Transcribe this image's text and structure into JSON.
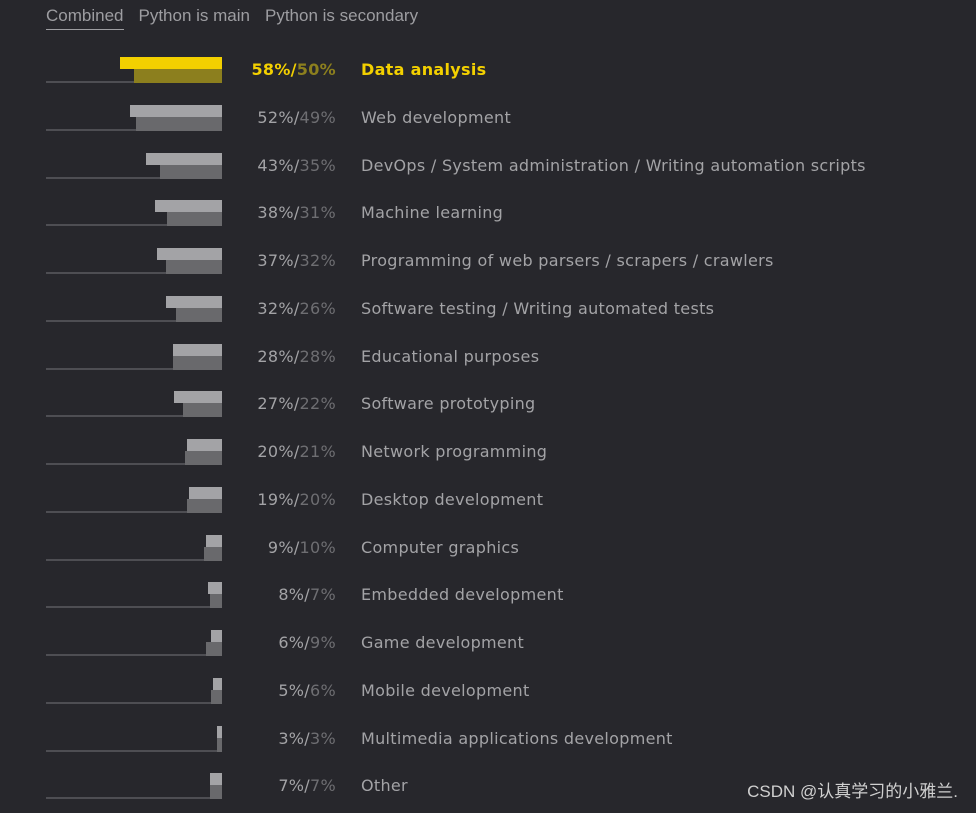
{
  "tabs": [
    {
      "label": "Combined",
      "active": true
    },
    {
      "label": "Python is main",
      "active": false
    },
    {
      "label": "Python is secondary",
      "active": false
    }
  ],
  "colors": {
    "highlight_main": "#f3d000",
    "highlight_secondary": "#8c7f1e",
    "main": "#a3a3a6",
    "secondary": "#69696c",
    "background": "#27272c"
  },
  "chart_data": {
    "type": "bar",
    "orientation": "horizontal",
    "title": "",
    "legend": [
      "Python is main",
      "Python is secondary"
    ],
    "xlim": [
      0,
      100
    ],
    "highlighted_index": 0,
    "categories": [
      "Data analysis",
      "Web development",
      "DevOps / System administration / Writing automation scripts",
      "Machine learning",
      "Programming of web parsers / scrapers / crawlers",
      "Software testing / Writing automated tests",
      "Educational purposes",
      "Software prototyping",
      "Network programming",
      "Desktop development",
      "Computer graphics",
      "Embedded development",
      "Game development",
      "Mobile development",
      "Multimedia applications development",
      "Other"
    ],
    "series": [
      {
        "name": "Python is main",
        "values": [
          58,
          52,
          43,
          38,
          37,
          32,
          28,
          27,
          20,
          19,
          9,
          8,
          6,
          5,
          3,
          7
        ]
      },
      {
        "name": "Python is secondary",
        "values": [
          50,
          49,
          35,
          31,
          32,
          26,
          28,
          22,
          21,
          20,
          10,
          7,
          9,
          6,
          3,
          7
        ]
      }
    ]
  },
  "watermark": "CSDN @认真学习的小雅兰."
}
